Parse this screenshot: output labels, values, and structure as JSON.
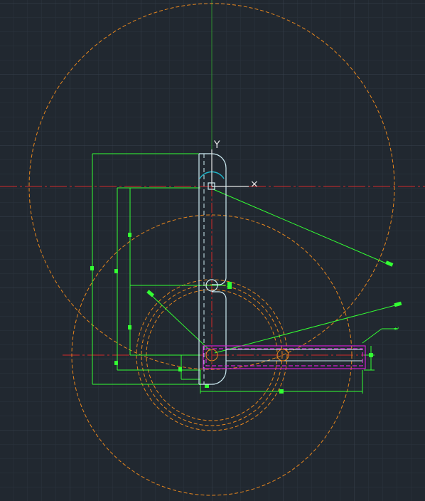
{
  "viewport": {
    "background": "#212830",
    "grid_color": "#2c3440",
    "grid_major_color": "#343d4a"
  },
  "ucs": {
    "y_label": "Y",
    "x_label": "×",
    "color": "#e6e6e6"
  },
  "dimensions": {
    "text_right": "±²"
  },
  "colors": {
    "centerline_red": "#d42a2a",
    "centerline_green": "#2f8f2f",
    "dashed_orange": "#e8871e",
    "dimension_green": "#33ff33",
    "part_cyan": "#cfeef5",
    "arc_cyan": "#1fb3c8",
    "slot_magenta": "#d21fd2"
  }
}
